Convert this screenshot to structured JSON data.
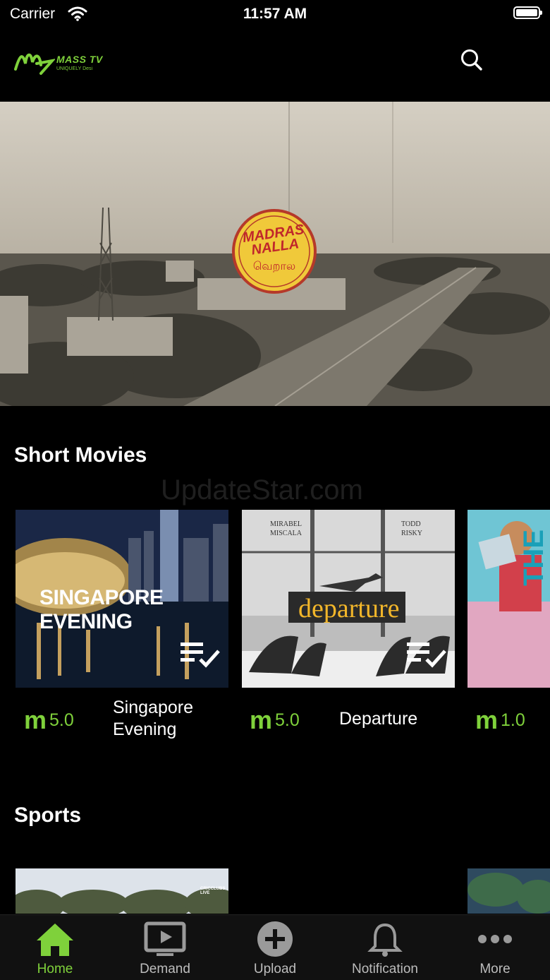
{
  "status_bar": {
    "carrier": "Carrier",
    "time": "11:57 AM"
  },
  "header": {
    "logo_text": "MASS TV",
    "logo_tagline": "UNIQUELY Desi",
    "search_icon": "search-icon"
  },
  "hero": {
    "badge_text": "MADRAS NALLA",
    "badge_subtext": "வெறால"
  },
  "watermark": "UpdateStar.com",
  "sections": {
    "short_movies": {
      "title": "Short Movies",
      "items": [
        {
          "title": "Singapore Evening",
          "title_line1": "Singapore",
          "title_line2": "Evening",
          "rating": "5.0",
          "poster_caption": "SINGAPORE EVENING"
        },
        {
          "title": "Departure",
          "rating": "5.0",
          "poster_caption": "departure",
          "poster_small_left": "MIRABEL\nMISCALA",
          "poster_small_right": "TODD\nRISKY"
        },
        {
          "title": "",
          "rating": "1.0",
          "poster_caption": "THE"
        }
      ]
    },
    "sports": {
      "title": "Sports",
      "thumb_caption": "CRICCLUBS LIVE"
    }
  },
  "tab_bar": {
    "tabs": [
      {
        "label": "Home",
        "icon": "home-icon",
        "active": true
      },
      {
        "label": "Demand",
        "icon": "tv-play-icon",
        "active": false
      },
      {
        "label": "Upload",
        "icon": "plus-circle-icon",
        "active": false
      },
      {
        "label": "Notification",
        "icon": "bell-icon",
        "active": false
      },
      {
        "label": "More",
        "icon": "more-dots-icon",
        "active": false
      }
    ]
  },
  "colors": {
    "accent": "#7fd13b",
    "background": "#000000",
    "tab_bar": "#111111"
  }
}
